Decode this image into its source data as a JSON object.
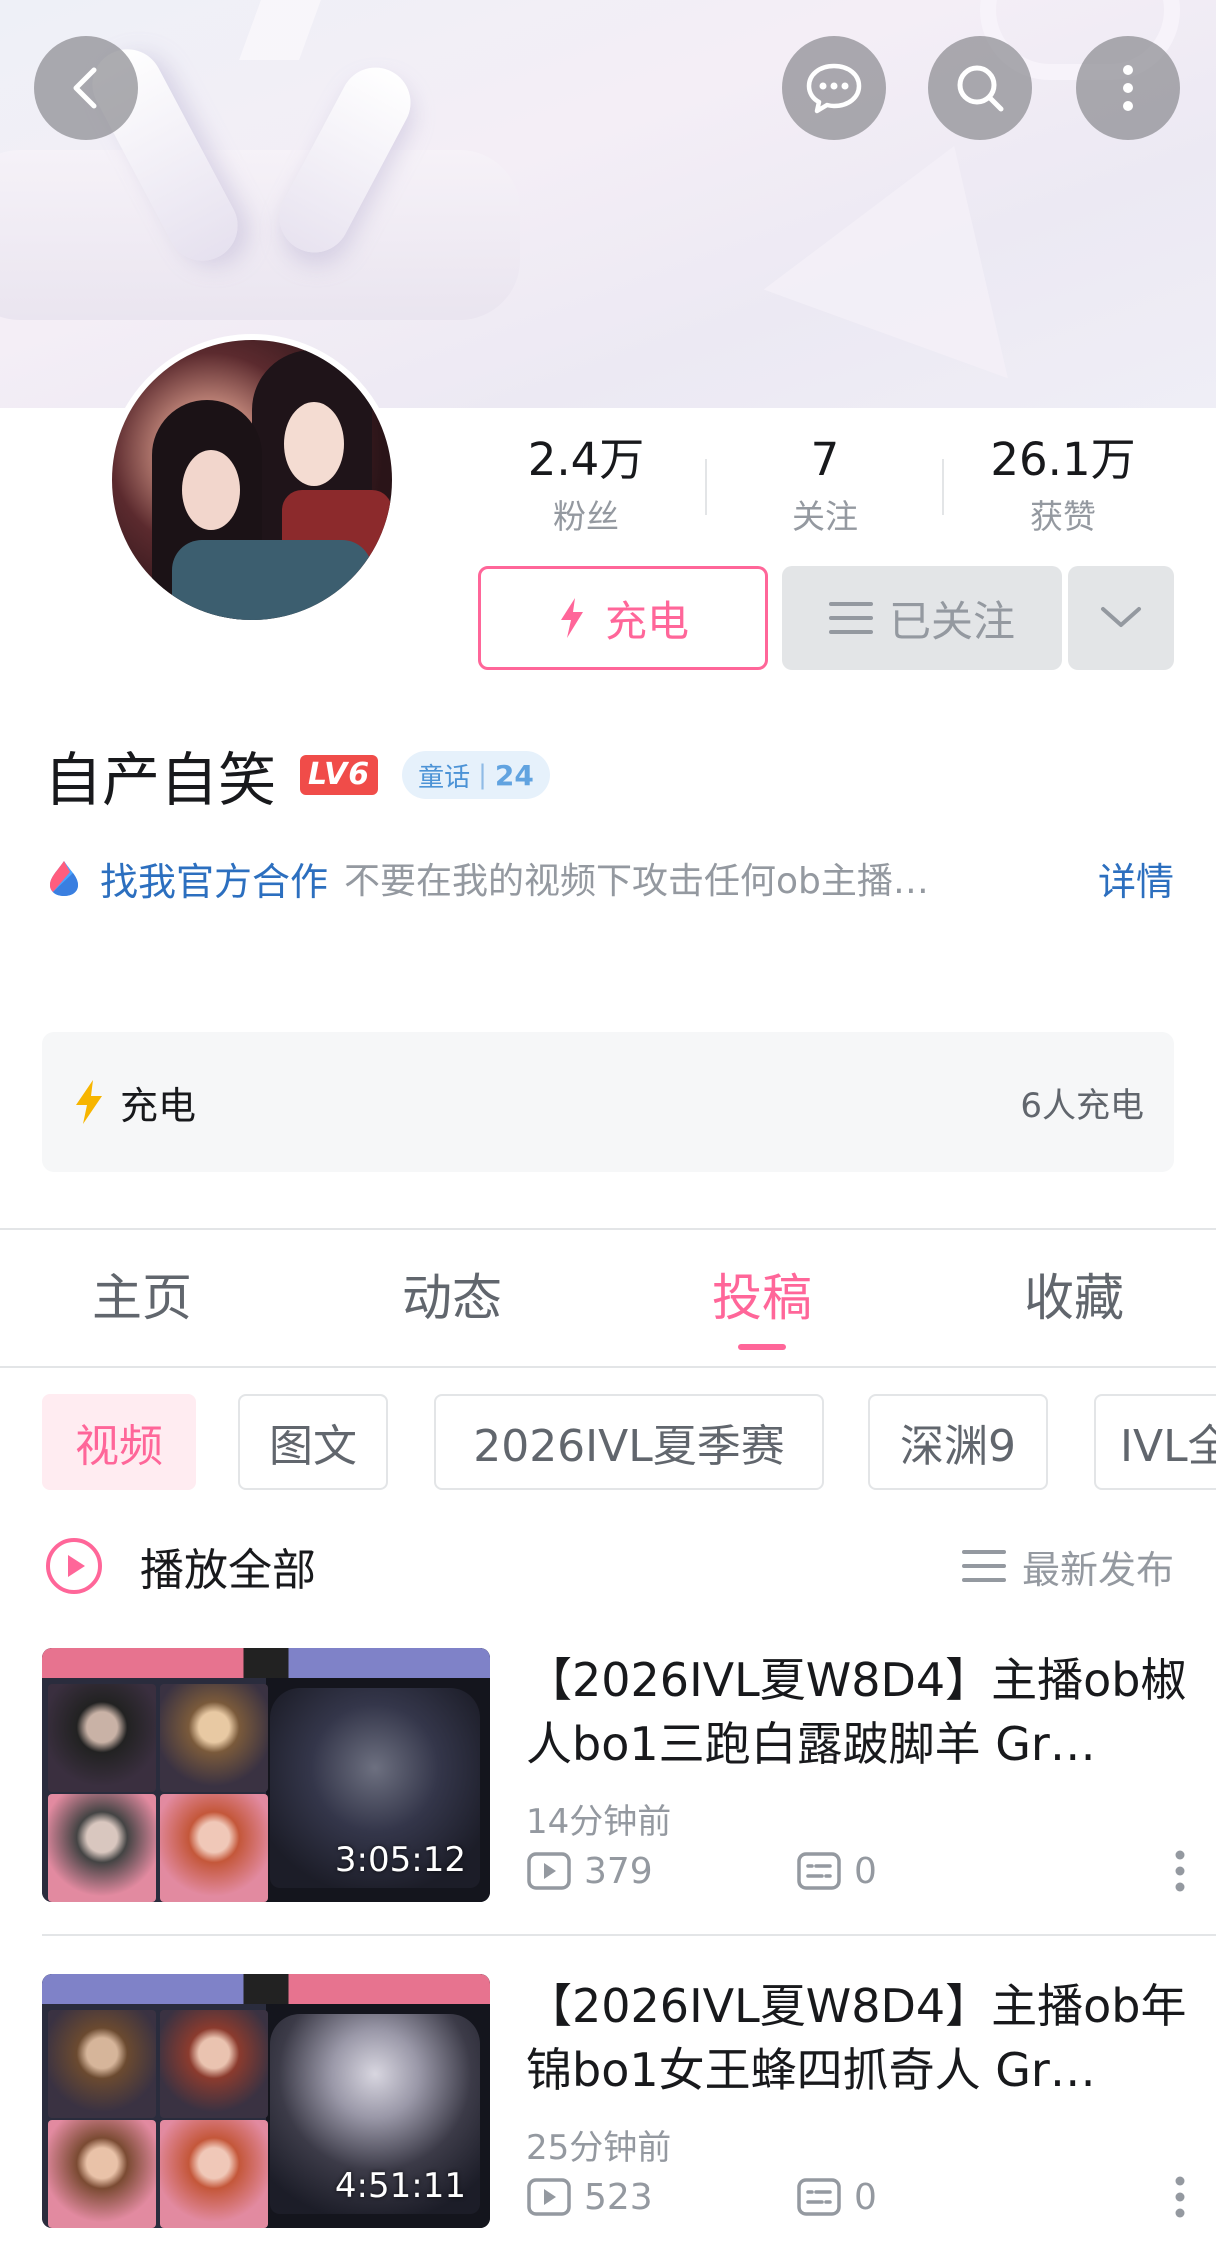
{
  "header": {
    "back_icon": "chevron-left-icon",
    "message_icon": "chat-bubble-icon",
    "search_icon": "search-icon",
    "more_icon": "more-vertical-icon"
  },
  "profile": {
    "stats": [
      {
        "value": "2.4万",
        "label": "粉丝"
      },
      {
        "value": "7",
        "label": "关注"
      },
      {
        "value": "26.1万",
        "label": "获赞"
      }
    ],
    "charge_button": "充电",
    "follow_button": "已关注",
    "name": "自产自笑",
    "level": "LV6",
    "medal": {
      "name": "童话",
      "level": "24"
    },
    "coop_link": "找我官方合作",
    "signature": "不要在我的视频下攻击任何ob主播…",
    "detail_link": "详情"
  },
  "charge_card": {
    "title": "充电",
    "count": "6人充电"
  },
  "tabs": [
    "主页",
    "动态",
    "投稿",
    "收藏"
  ],
  "active_tab": "投稿",
  "chips": [
    "视频",
    "图文",
    "2026IVL夏季赛",
    "深渊9",
    "IVL全"
  ],
  "play_all": {
    "label": "播放全部",
    "sort_label": "最新发布"
  },
  "videos": [
    {
      "title": "【2026IVL夏W8D4】主播ob椒人bo1三跑白露跛脚羊 Gr…",
      "duration": "3:05:12",
      "time": "14分钟前",
      "views": "379",
      "comments": "0"
    },
    {
      "title": "【2026IVL夏W8D4】主播ob年锦bo1女王蜂四抓奇人 Gr…",
      "duration": "4:51:11",
      "time": "25分钟前",
      "views": "523",
      "comments": "0"
    }
  ],
  "colors": {
    "accent": "#ff6699",
    "link": "#2c6fbf",
    "muted": "#9499a0"
  }
}
